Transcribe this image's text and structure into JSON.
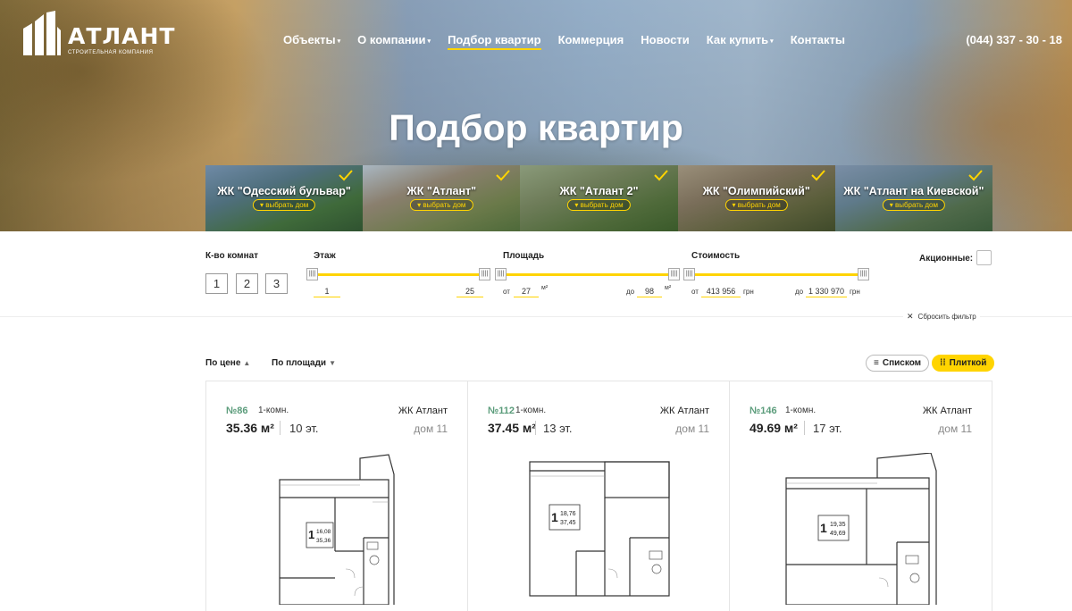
{
  "brand": {
    "name": "АТЛАНТ",
    "tagline": "СТРОИТЕЛЬНАЯ КОМПАНИЯ"
  },
  "nav": [
    {
      "label": "Объекты",
      "dropdown": true
    },
    {
      "label": "О компании",
      "dropdown": true
    },
    {
      "label": "Подбор квартир",
      "dropdown": false,
      "active": true
    },
    {
      "label": "Коммерция",
      "dropdown": false
    },
    {
      "label": "Новости",
      "dropdown": false
    },
    {
      "label": "Как купить",
      "dropdown": true
    },
    {
      "label": "Контакты",
      "dropdown": false
    }
  ],
  "phone": "(044) 337 - 30 - 18",
  "page_title": "Подбор квартир",
  "complexes": [
    {
      "title": "ЖК \"Одесский бульвар\"",
      "button": "▾ выбрать дом",
      "checked": true
    },
    {
      "title": "ЖК \"Атлант\"",
      "button": "▾ выбрать дом",
      "checked": true
    },
    {
      "title": "ЖК \"Атлант 2\"",
      "button": "▾ выбрать дом",
      "checked": true
    },
    {
      "title": "ЖК \"Олимпийский\"",
      "button": "▾ выбрать дом",
      "checked": true
    },
    {
      "title": "ЖК \"Атлант на Киевской\"",
      "button": "▾ выбрать дом",
      "checked": true
    }
  ],
  "filter": {
    "rooms": {
      "label": "К-во комнат",
      "options": [
        "1",
        "2",
        "3"
      ]
    },
    "floor": {
      "label": "Этаж",
      "from": "1",
      "to": "25"
    },
    "area": {
      "label": "Площадь",
      "from_prefix": "от",
      "from": "27",
      "to_prefix": "до",
      "to": "98",
      "unit": "м²"
    },
    "price": {
      "label": "Стоимость",
      "from_prefix": "от",
      "from": "413 956",
      "to_prefix": "до",
      "to": "1 330 970",
      "unit": "грн"
    },
    "promo_label": "Акционные:",
    "promo_checked": false,
    "reset_label": "Сбросить фильтр"
  },
  "sort": {
    "by_price": "По цене",
    "by_area": "По площади",
    "view_list": "Списком",
    "view_tile": "Плиткой"
  },
  "colors": {
    "accent": "#ffd400",
    "number_green": "#5b9c7b"
  },
  "apartments": [
    {
      "number": "№86",
      "rooms": "1-комн.",
      "complex": "ЖК Атлант",
      "area": "35.36 м²",
      "floor": "10 эт.",
      "house": "дом 11",
      "plan_living": "16,08",
      "plan_total": "35,36"
    },
    {
      "number": "№112",
      "rooms": "1-комн.",
      "complex": "ЖК Атлант",
      "area": "37.45 м²",
      "floor": "13 эт.",
      "house": "дом 11",
      "plan_living": "18,76",
      "plan_total": "37,45"
    },
    {
      "number": "№146",
      "rooms": "1-комн.",
      "complex": "ЖК Атлант",
      "area": "49.69 м²",
      "floor": "17 эт.",
      "house": "дом 11",
      "plan_living": "19,35",
      "plan_total": "49,69"
    }
  ]
}
